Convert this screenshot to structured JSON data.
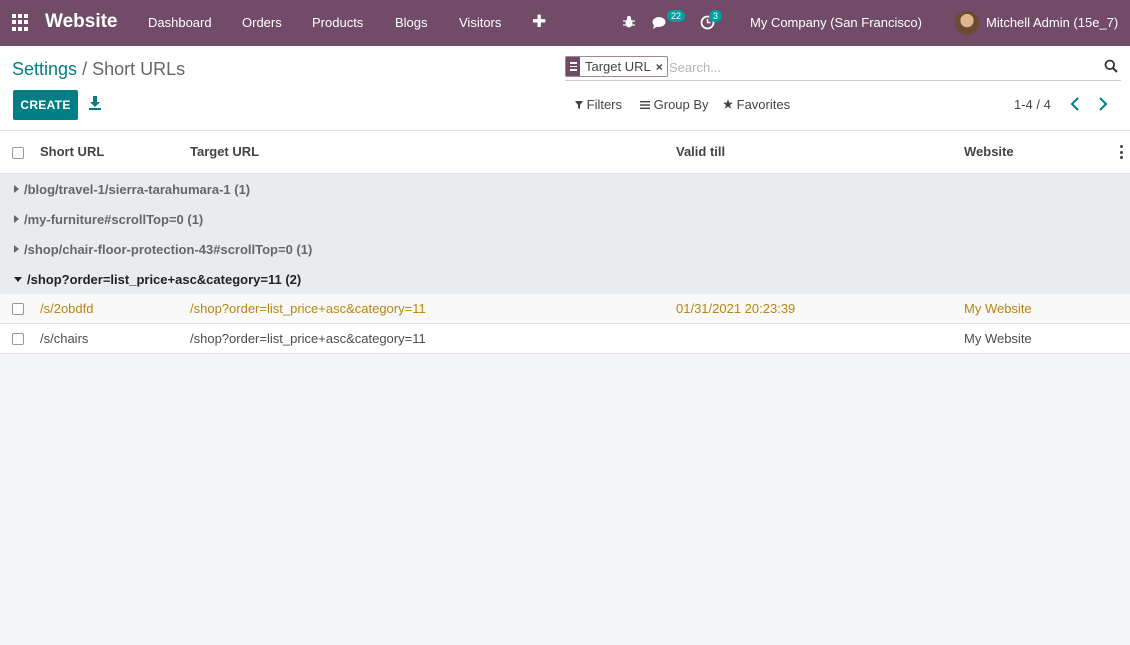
{
  "navbar": {
    "brand": "Website",
    "menus": [
      "Dashboard",
      "Orders",
      "Products",
      "Blogs",
      "Visitors"
    ],
    "plus": "✚",
    "messages_count": "22",
    "activities_count": "3",
    "company": "My Company (San Francisco)",
    "user": "Mitchell Admin (15e_7)"
  },
  "breadcrumb": {
    "parent": "Settings",
    "separator": "/",
    "current": "Short URLs"
  },
  "toolbar": {
    "create_label": "CREATE"
  },
  "search": {
    "facet_value": "Target URL",
    "facet_remove": "×",
    "placeholder": "Search..."
  },
  "filters": {
    "filters_label": "Filters",
    "group_by_label": "Group By",
    "favorites_label": "Favorites"
  },
  "pager": {
    "value": "1-4 / 4"
  },
  "table": {
    "headers": [
      "Short URL",
      "Target URL",
      "Valid till",
      "Website"
    ],
    "groups": [
      {
        "label": "/blog/travel-1/sierra-tarahumara-1 (1)"
      },
      {
        "label": "/my-furniture#scrollTop=0 (1)"
      },
      {
        "label": "/shop/chair-floor-protection-43#scrollTop=0 (1)"
      },
      {
        "label": "/shop?order=list_price+asc&category=11 (2)"
      }
    ],
    "rows": [
      {
        "short_url": "/s/2obdfd",
        "target_url": "/shop?order=list_price+asc&category=11",
        "valid_till": "01/31/2021 20:23:39",
        "website": "My Website"
      },
      {
        "short_url": "/s/chairs",
        "target_url": "/shop?order=list_price+asc&category=11",
        "valid_till": "",
        "website": "My Website"
      }
    ]
  },
  "colors": {
    "brand": "#714b67",
    "primary": "#017e84",
    "warning_text": "#b8860b"
  }
}
